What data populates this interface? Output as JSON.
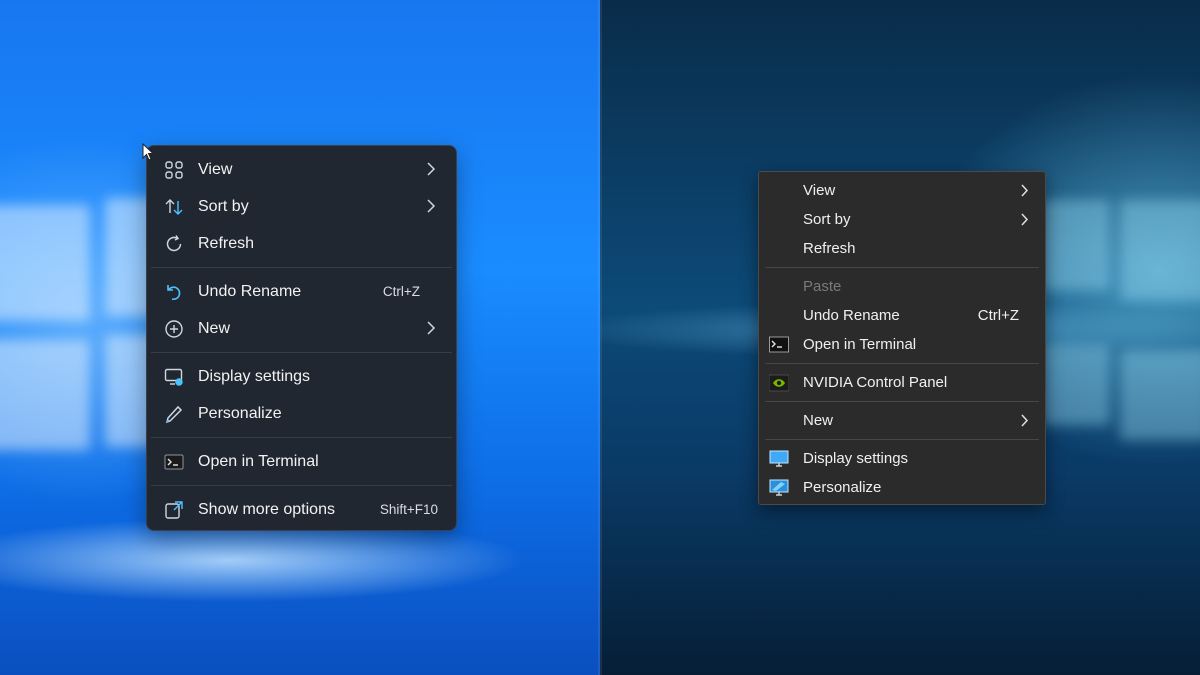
{
  "left_menu": {
    "items": [
      {
        "label": "View",
        "icon": "grid-view-icon",
        "shortcut": "",
        "submenu": true
      },
      {
        "label": "Sort by",
        "icon": "sort-arrows-icon",
        "shortcut": "",
        "submenu": true
      },
      {
        "label": "Refresh",
        "icon": "refresh-icon",
        "shortcut": "",
        "submenu": false
      },
      {
        "label": "Undo Rename",
        "icon": "undo-icon",
        "shortcut": "Ctrl+Z",
        "submenu": false
      },
      {
        "label": "New",
        "icon": "plus-circle-icon",
        "shortcut": "",
        "submenu": true
      },
      {
        "label": "Display settings",
        "icon": "display-settings-icon",
        "shortcut": "",
        "submenu": false
      },
      {
        "label": "Personalize",
        "icon": "pen-icon",
        "shortcut": "",
        "submenu": false
      },
      {
        "label": "Open in Terminal",
        "icon": "terminal-icon",
        "shortcut": "",
        "submenu": false
      },
      {
        "label": "Show more options",
        "icon": "show-more-icon",
        "shortcut": "Shift+F10",
        "submenu": false
      }
    ]
  },
  "right_menu": {
    "items": [
      {
        "label": "View",
        "shortcut": "",
        "submenu": true,
        "disabled": false
      },
      {
        "label": "Sort by",
        "shortcut": "",
        "submenu": true,
        "disabled": false
      },
      {
        "label": "Refresh",
        "shortcut": "",
        "submenu": false,
        "disabled": false
      },
      {
        "label": "Paste",
        "shortcut": "",
        "submenu": false,
        "disabled": true
      },
      {
        "label": "Undo Rename",
        "shortcut": "Ctrl+Z",
        "submenu": false,
        "disabled": false
      },
      {
        "label": "Open in Terminal",
        "icon": "terminal-icon",
        "shortcut": "",
        "submenu": false,
        "disabled": false
      },
      {
        "label": "NVIDIA Control Panel",
        "icon": "nvidia-icon",
        "shortcut": "",
        "submenu": false,
        "disabled": false
      },
      {
        "label": "New",
        "shortcut": "",
        "submenu": true,
        "disabled": false
      },
      {
        "label": "Display settings",
        "icon": "monitor-icon",
        "shortcut": "",
        "submenu": false,
        "disabled": false
      },
      {
        "label": "Personalize",
        "icon": "personalize-icon",
        "shortcut": "",
        "submenu": false,
        "disabled": false
      }
    ]
  },
  "colors": {
    "win11_menu_bg": "#212731",
    "win10_menu_bg": "#2b2b2b",
    "accent_icon": "#4cc2ff",
    "nvidia_green": "#76b900"
  }
}
